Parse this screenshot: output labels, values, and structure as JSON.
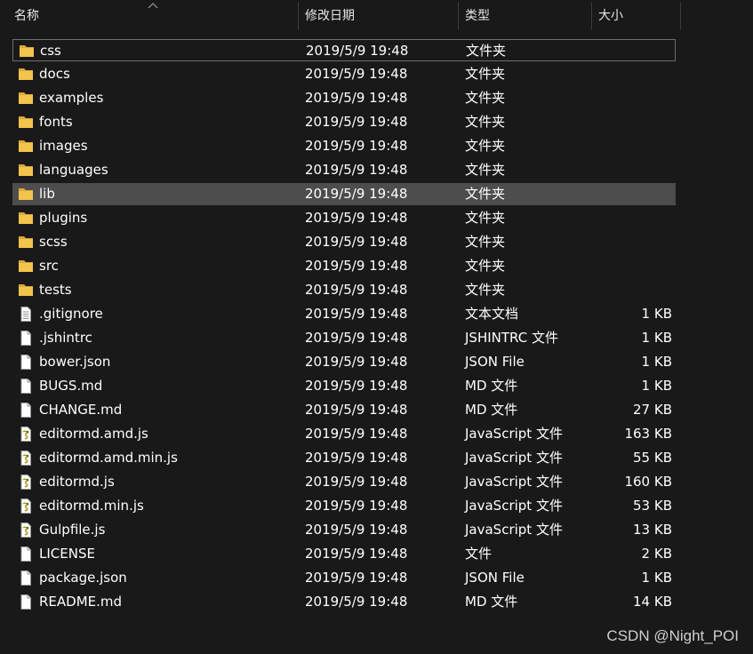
{
  "columns": {
    "name": "名称",
    "date": "修改日期",
    "type": "类型",
    "size": "大小"
  },
  "files": [
    {
      "name": "css",
      "date": "2019/5/9 19:48",
      "type": "文件夹",
      "size": "",
      "icon": "folder-icon",
      "state": "focused"
    },
    {
      "name": "docs",
      "date": "2019/5/9 19:48",
      "type": "文件夹",
      "size": "",
      "icon": "folder-icon"
    },
    {
      "name": "examples",
      "date": "2019/5/9 19:48",
      "type": "文件夹",
      "size": "",
      "icon": "folder-icon"
    },
    {
      "name": "fonts",
      "date": "2019/5/9 19:48",
      "type": "文件夹",
      "size": "",
      "icon": "folder-icon"
    },
    {
      "name": "images",
      "date": "2019/5/9 19:48",
      "type": "文件夹",
      "size": "",
      "icon": "folder-icon"
    },
    {
      "name": "languages",
      "date": "2019/5/9 19:48",
      "type": "文件夹",
      "size": "",
      "icon": "folder-icon"
    },
    {
      "name": "lib",
      "date": "2019/5/9 19:48",
      "type": "文件夹",
      "size": "",
      "icon": "folder-icon",
      "state": "hover"
    },
    {
      "name": "plugins",
      "date": "2019/5/9 19:48",
      "type": "文件夹",
      "size": "",
      "icon": "folder-icon"
    },
    {
      "name": "scss",
      "date": "2019/5/9 19:48",
      "type": "文件夹",
      "size": "",
      "icon": "folder-icon"
    },
    {
      "name": "src",
      "date": "2019/5/9 19:48",
      "type": "文件夹",
      "size": "",
      "icon": "folder-icon"
    },
    {
      "name": "tests",
      "date": "2019/5/9 19:48",
      "type": "文件夹",
      "size": "",
      "icon": "folder-icon"
    },
    {
      "name": ".gitignore",
      "date": "2019/5/9 19:48",
      "type": "文本文档",
      "size": "1 KB",
      "icon": "text-document-icon"
    },
    {
      "name": ".jshintrc",
      "date": "2019/5/9 19:48",
      "type": "JSHINTRC 文件",
      "size": "1 KB",
      "icon": "blank-file-icon"
    },
    {
      "name": "bower.json",
      "date": "2019/5/9 19:48",
      "type": "JSON File",
      "size": "1 KB",
      "icon": "blank-file-icon"
    },
    {
      "name": "BUGS.md",
      "date": "2019/5/9 19:48",
      "type": "MD 文件",
      "size": "1 KB",
      "icon": "blank-file-icon"
    },
    {
      "name": "CHANGE.md",
      "date": "2019/5/9 19:48",
      "type": "MD 文件",
      "size": "27 KB",
      "icon": "blank-file-icon"
    },
    {
      "name": "editormd.amd.js",
      "date": "2019/5/9 19:48",
      "type": "JavaScript 文件",
      "size": "163 KB",
      "icon": "javascript-file-icon"
    },
    {
      "name": "editormd.amd.min.js",
      "date": "2019/5/9 19:48",
      "type": "JavaScript 文件",
      "size": "55 KB",
      "icon": "javascript-file-icon"
    },
    {
      "name": "editormd.js",
      "date": "2019/5/9 19:48",
      "type": "JavaScript 文件",
      "size": "160 KB",
      "icon": "javascript-file-icon"
    },
    {
      "name": "editormd.min.js",
      "date": "2019/5/9 19:48",
      "type": "JavaScript 文件",
      "size": "53 KB",
      "icon": "javascript-file-icon"
    },
    {
      "name": "Gulpfile.js",
      "date": "2019/5/9 19:48",
      "type": "JavaScript 文件",
      "size": "13 KB",
      "icon": "javascript-file-icon"
    },
    {
      "name": "LICENSE",
      "date": "2019/5/9 19:48",
      "type": "文件",
      "size": "2 KB",
      "icon": "blank-file-icon"
    },
    {
      "name": "package.json",
      "date": "2019/5/9 19:48",
      "type": "JSON File",
      "size": "1 KB",
      "icon": "blank-file-icon"
    },
    {
      "name": "README.md",
      "date": "2019/5/9 19:48",
      "type": "MD 文件",
      "size": "14 KB",
      "icon": "blank-file-icon"
    }
  ],
  "watermark": "CSDN @Night_POI",
  "colors": {
    "background": "#191919",
    "focus_border": "#6e6e6e",
    "hover_background": "#4d4d4d",
    "folder": "#f3c44c"
  }
}
